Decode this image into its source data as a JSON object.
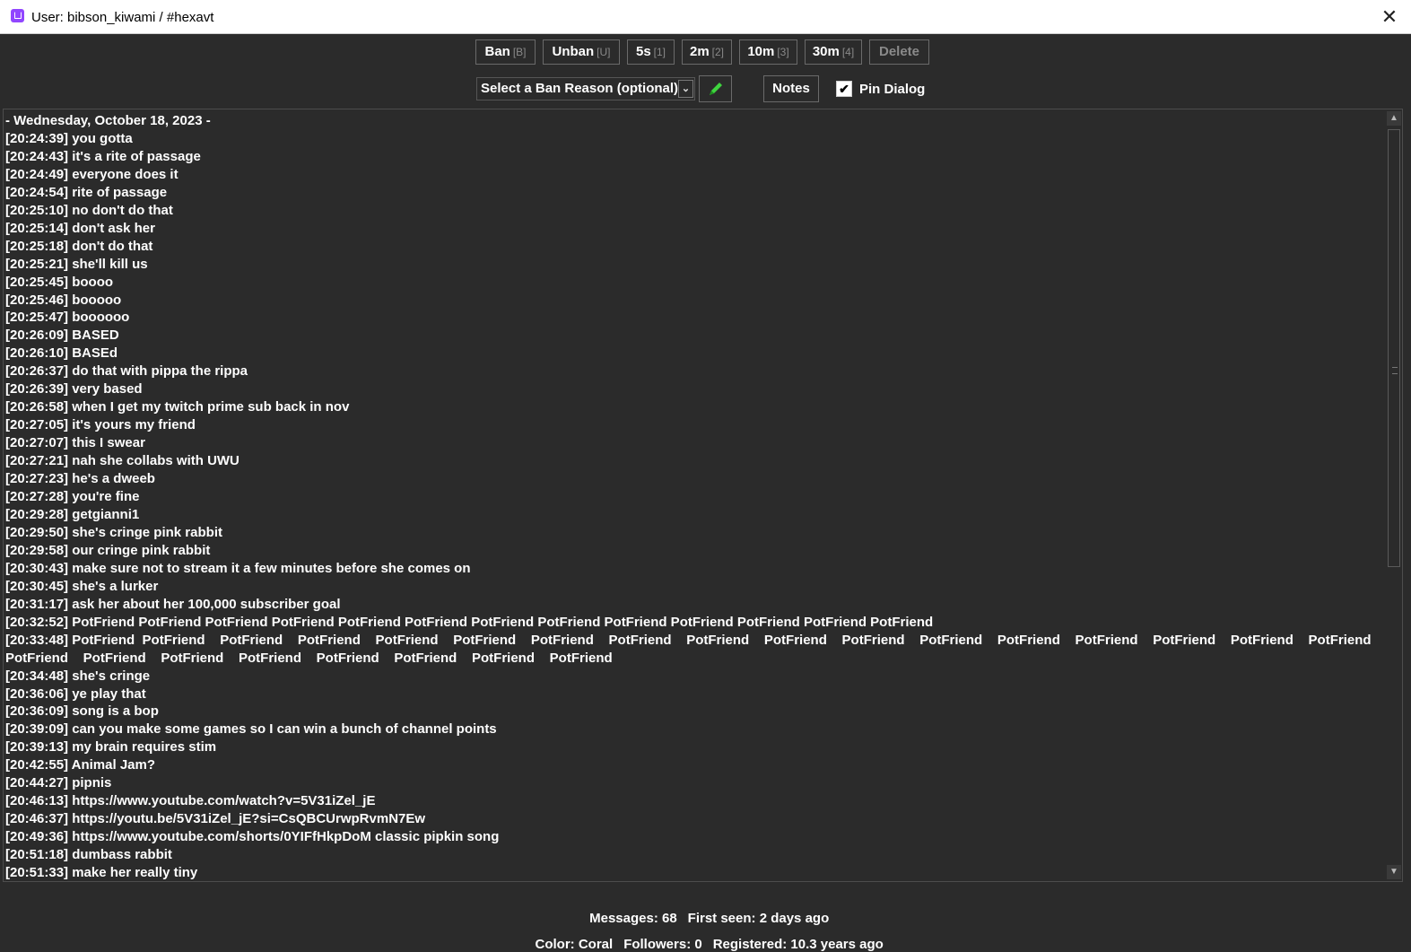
{
  "window": {
    "title": "User: bibson_kiwami / #hexavt",
    "close_glyph": "✕"
  },
  "actions": {
    "ban": {
      "label": "Ban",
      "key": "[B]"
    },
    "unban": {
      "label": "Unban",
      "key": "[U]"
    },
    "t5s": {
      "label": "5s",
      "key": "[1]"
    },
    "t2m": {
      "label": "2m",
      "key": "[2]"
    },
    "t10m": {
      "label": "10m",
      "key": "[3]"
    },
    "t30m": {
      "label": "30m",
      "key": "[4]"
    },
    "delete": {
      "label": "Delete"
    }
  },
  "ban_reason": {
    "selected": "Select a Ban Reason (optional)"
  },
  "notes_label": "Notes",
  "pin_dialog": {
    "label": "Pin Dialog",
    "checked": true,
    "check_glyph": "✔"
  },
  "chat": {
    "lines": [
      "- Wednesday, October 18, 2023 -",
      "[20:24:39] you gotta",
      "[20:24:43] it's a rite of passage",
      "[20:24:49] everyone does it",
      "[20:24:54] rite of passage",
      "[20:25:10] no don't do that",
      "[20:25:14] don't ask her",
      "[20:25:18] don't do that",
      "[20:25:21] she'll kill us",
      "[20:25:45] boooo",
      "[20:25:46] booooo",
      "[20:25:47] boooooo",
      "[20:26:09] BASED",
      "[20:26:10] BASEd",
      "[20:26:37] do that with pippa the rippa",
      "[20:26:39] very based",
      "[20:26:58] when I get my twitch prime sub back in nov",
      "[20:27:05] it's yours my friend",
      "[20:27:07] this I swear",
      "[20:27:21] nah she collabs with UWU",
      "[20:27:23] he's a dweeb",
      "[20:27:28] you're fine",
      "[20:29:28] getgianni1",
      "[20:29:50] she's cringe pink rabbit",
      "[20:29:58] our cringe pink rabbit",
      "[20:30:43] make sure not to stream it a few minutes before she comes on",
      "[20:30:45] she's a lurker",
      "[20:31:17] ask her about her 100,000 subscriber goal",
      "[20:32:52] PotFriend PotFriend PotFriend PotFriend PotFriend PotFriend PotFriend PotFriend PotFriend PotFriend PotFriend PotFriend PotFriend",
      "[20:33:48] PotFriend  PotFriend    PotFriend    PotFriend    PotFriend    PotFriend    PotFriend    PotFriend    PotFriend    PotFriend    PotFriend    PotFriend    PotFriend    PotFriend    PotFriend    PotFriend    PotFriend    PotFriend    PotFriend    PotFriend    PotFriend    PotFriend    PotFriend    PotFriend    PotFriend",
      "[20:34:48] she's cringe",
      "[20:36:06] ye play that",
      "[20:36:09] song is a bop",
      "[20:39:09] can you make some games so I can win a bunch of channel points",
      "[20:39:13] my brain requires stim",
      "[20:42:55] Animal Jam?",
      "[20:44:27] pipnis",
      "[20:46:13] https://www.youtube.com/watch?v=5V31iZel_jE",
      "[20:46:37] https://youtu.be/5V31iZel_jE?si=CsQBCUrwpRvmN7Ew",
      "[20:49:36] https://www.youtube.com/shorts/0YIFfHkpDoM classic pipkin song",
      "[20:51:18] dumbass rabbit",
      "[20:51:33] make her really tiny"
    ]
  },
  "stats": {
    "messages": "Messages: 68",
    "first_seen": "First seen: 2 days ago",
    "color": "Color: Coral",
    "followers": "Followers: 0",
    "registered": "Registered: 10.3 years ago"
  },
  "icons": {
    "app": "twitch-icon",
    "close": "close-icon",
    "dropdown": "chevron-down-icon",
    "edit": "pencil-icon"
  },
  "colors": {
    "background": "#2b2b2b",
    "text": "#ffffff",
    "muted": "#8a8a8a",
    "accent_green": "#3fd43f",
    "app_purple": "#9146ff"
  }
}
